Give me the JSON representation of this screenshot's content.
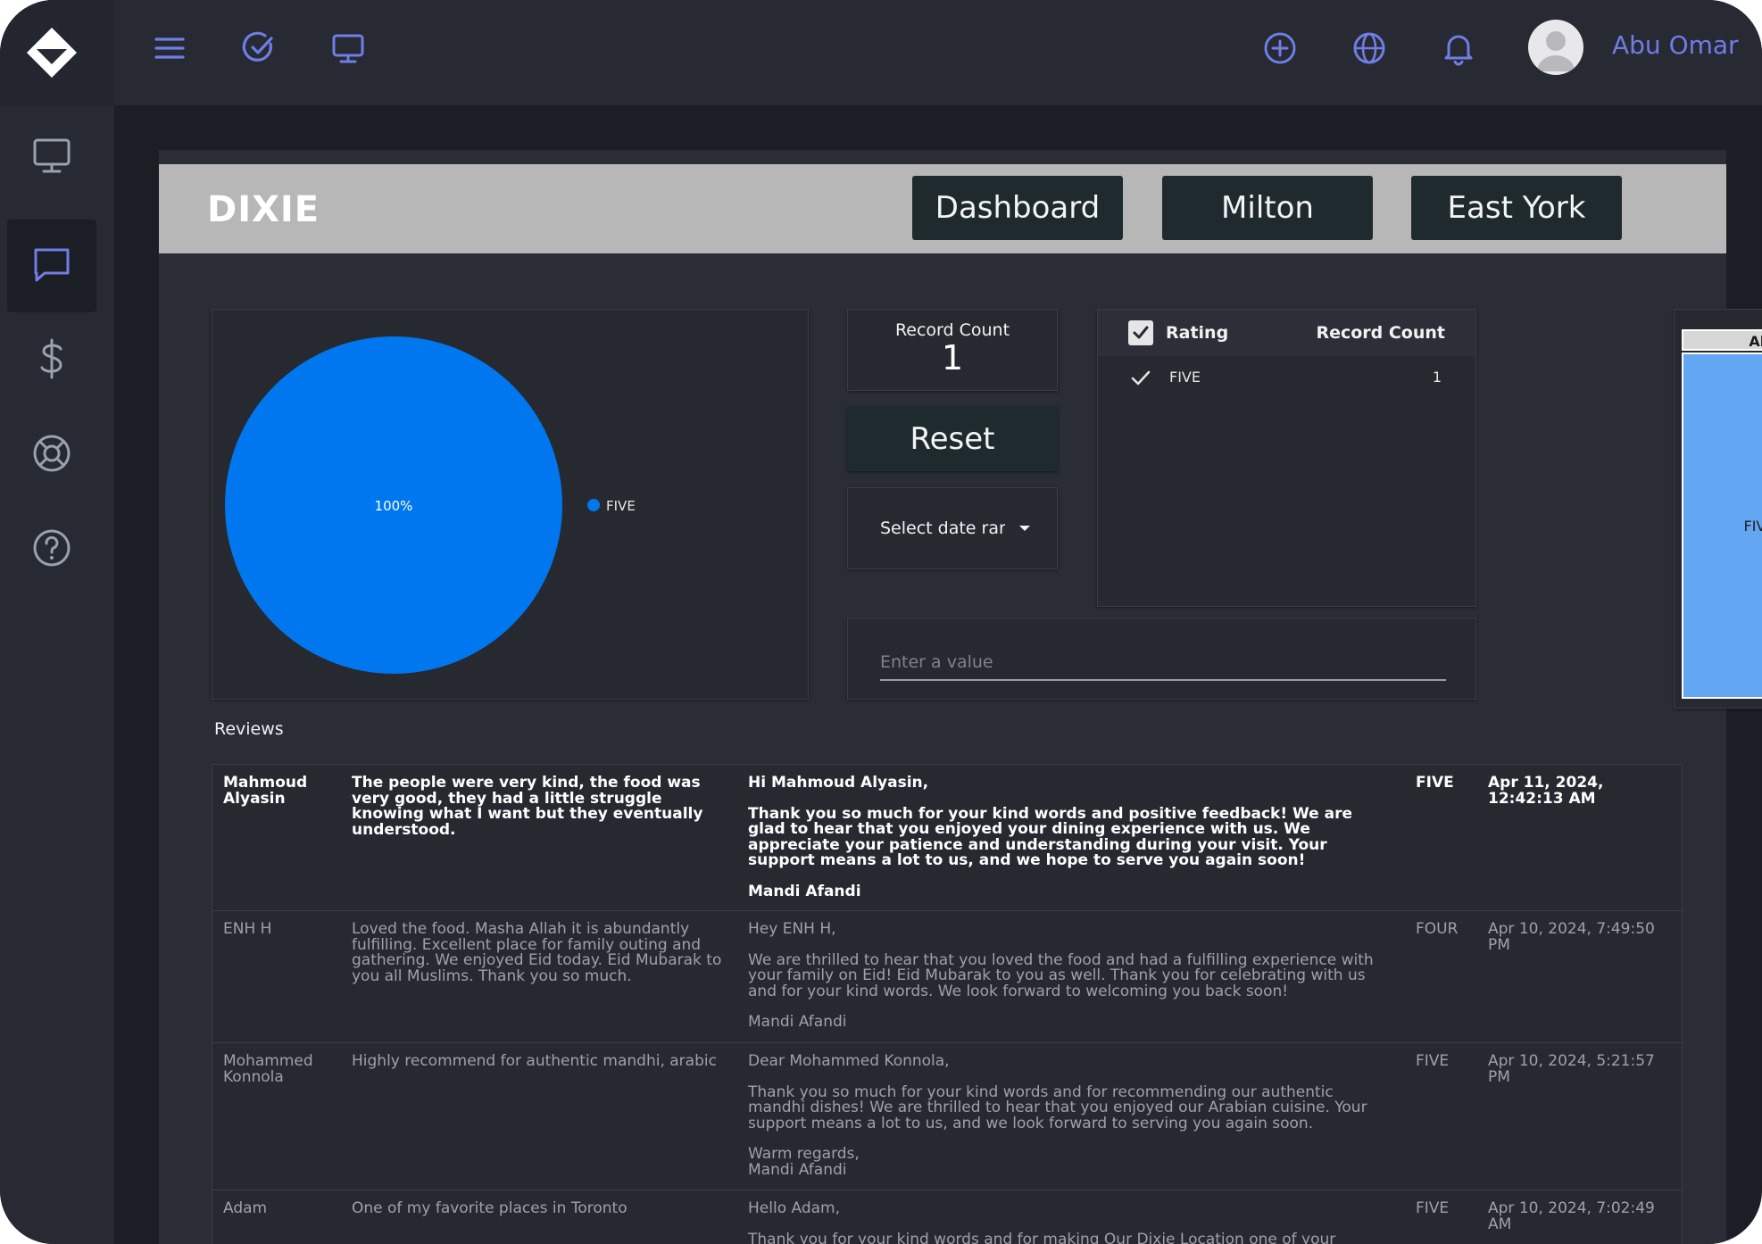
{
  "app": {
    "user_name": "Abu Omar"
  },
  "topbar": {
    "icons": [
      "menu-icon",
      "check-circle-icon",
      "monitor-icon",
      "plus-circle-icon",
      "globe-icon",
      "bell-icon"
    ]
  },
  "sidebar": {
    "items": [
      {
        "icon": "monitor-icon",
        "active": false
      },
      {
        "icon": "chat-icon",
        "active": true
      },
      {
        "icon": "dollar-icon",
        "active": false
      },
      {
        "icon": "lifebuoy-icon",
        "active": false
      },
      {
        "icon": "help-icon",
        "active": false
      }
    ]
  },
  "header": {
    "title": "DIXIE",
    "buttons": [
      "Dashboard",
      "Milton",
      "East York"
    ]
  },
  "colors": {
    "pie_blue": "#0077ee",
    "accent": "#6f7de6",
    "filter_blue": "#63a7f3"
  },
  "chart_data": {
    "type": "pie",
    "slices": [
      {
        "label": "FIVE",
        "value": 100,
        "display": "100%"
      }
    ],
    "legend": [
      "FIVE"
    ],
    "legend_position": "right"
  },
  "record_count": {
    "label": "Record Count",
    "value": "1"
  },
  "reset_label": "Reset",
  "date_select": {
    "text": "Select date range"
  },
  "rating_table": {
    "headers": [
      "Rating",
      "Record Count"
    ],
    "rows": [
      {
        "rating": "FIVE",
        "count": "1"
      }
    ]
  },
  "filter": {
    "all_label": "All",
    "five_label": "FIVE"
  },
  "value_input": {
    "placeholder": "Enter a value"
  },
  "reviews": {
    "title": "Reviews",
    "rows": [
      {
        "name": "Mahmoud Alyasin",
        "review": "The people were very kind, the food was very good, they had a little struggle knowing what I want but they eventually understood.",
        "reply_greeting": "Hi Mahmoud Alyasin,",
        "reply_body": "Thank you so much for your kind words and positive feedback! We are glad to hear that you enjoyed your dining experience with us. We appreciate your patience and understanding during your visit. Your support means a lot to us, and we hope to serve you again soon!",
        "reply_sign1": "Mandi Afandi",
        "reply_sign2": "",
        "rating": "FIVE",
        "date": "Apr 11, 2024, 12:42:13 AM",
        "selected": true
      },
      {
        "name": "ENH H",
        "review": "Loved the food. Masha Allah it is abundantly fulfilling. Excellent place for family outing and gathering. We enjoyed Eid today. Eid Mubarak to you all Muslims. Thank you so much.",
        "reply_greeting": "Hey ENH H,",
        "reply_body": "We are thrilled to hear that you loved the food and had a fulfilling experience with your family on Eid! Eid Mubarak to you as well. Thank you for celebrating with us and for your kind words. We look forward to welcoming you back soon!",
        "reply_sign1": "Mandi Afandi",
        "reply_sign2": "",
        "rating": "FOUR",
        "date": "Apr 10, 2024, 7:49:50 PM",
        "selected": false
      },
      {
        "name": "Mohammed Konnola",
        "review": "Highly recommend for authentic mandhi, arabic",
        "reply_greeting": "Dear Mohammed Konnola,",
        "reply_body": "Thank you so much for your kind words and for recommending our authentic mandhi dishes! We are thrilled to hear that you enjoyed our Arabian cuisine. Your support means a lot to us, and we look forward to serving you again soon.",
        "reply_sign1": "Warm regards,",
        "reply_sign2": "Mandi Afandi",
        "rating": "FIVE",
        "date": "Apr 10, 2024, 5:21:57 PM",
        "selected": false
      },
      {
        "name": "Adam",
        "review": "One of my favorite places in Toronto",
        "reply_greeting": "Hello Adam,",
        "reply_body": "Thank you for your kind words and for making Our Dixie Location one of your favorite",
        "reply_sign1": "",
        "reply_sign2": "",
        "rating": "FIVE",
        "date": "Apr 10, 2024, 7:02:49 AM",
        "selected": false
      }
    ]
  }
}
